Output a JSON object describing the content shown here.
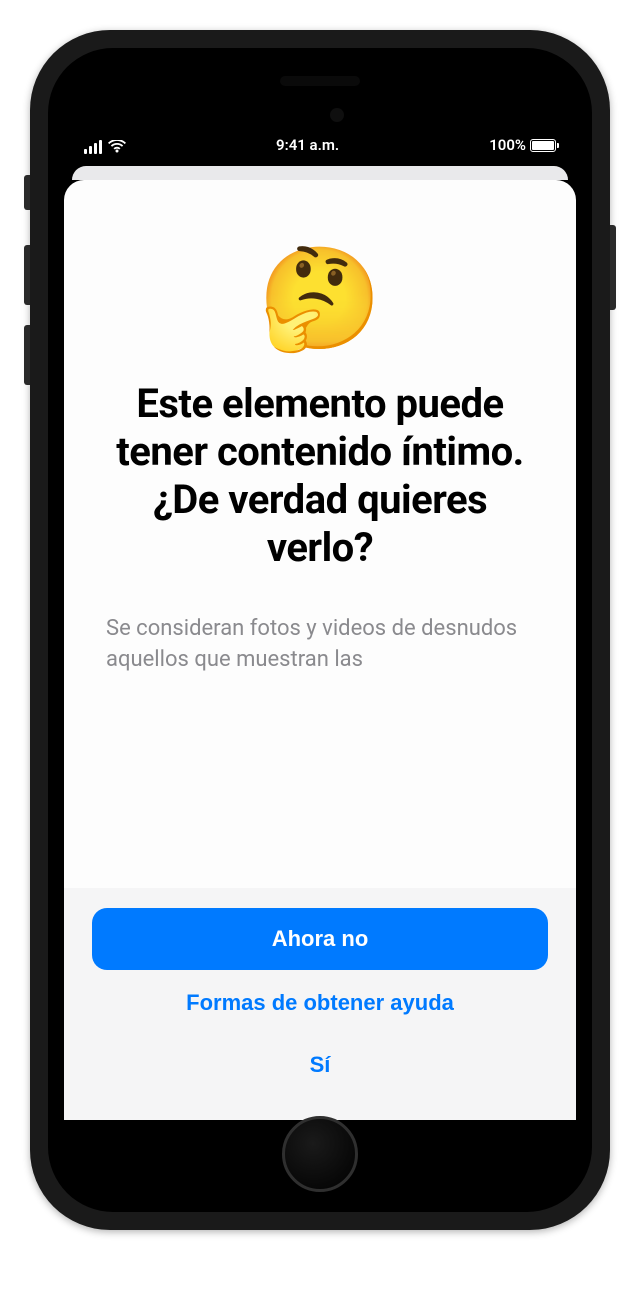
{
  "status": {
    "time": "9:41 a.m.",
    "battery_pct": "100%"
  },
  "dialog": {
    "emoji": "🤔",
    "title": "Este elemento puede tener contenido íntimo. ¿De verdad quieres verlo?",
    "body": "Se consideran fotos y videos de desnudos aquellos que muestran las"
  },
  "actions": {
    "primary": "Ahora no",
    "help": "Formas de obtener ayuda",
    "confirm": "Sí"
  }
}
